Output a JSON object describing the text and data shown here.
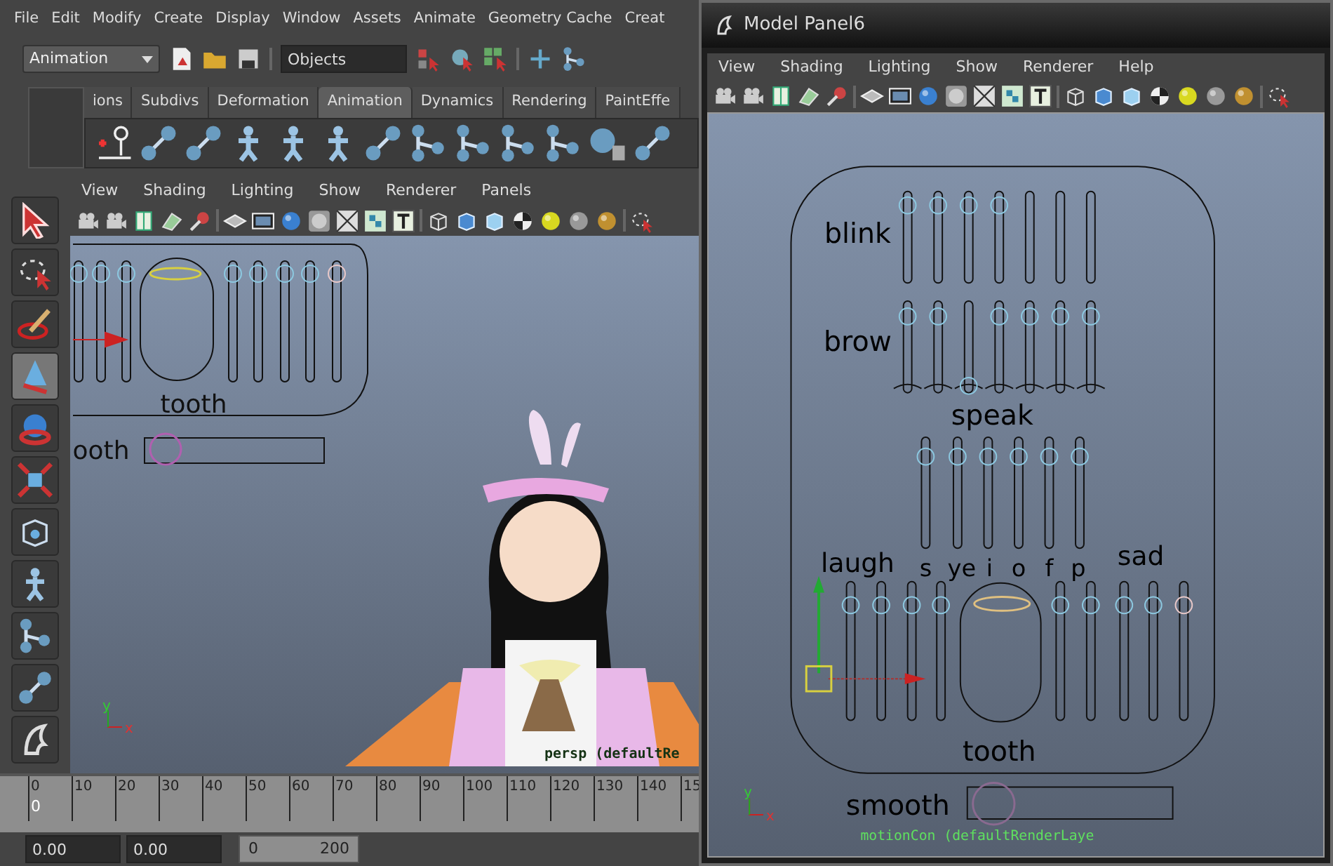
{
  "main_window": {
    "menu": [
      "File",
      "Edit",
      "Modify",
      "Create",
      "Display",
      "Window",
      "Assets",
      "Animate",
      "Geometry Cache",
      "Creat"
    ],
    "mode_menu": "Animation",
    "selection_mask": "Objects",
    "shelf_tabs": [
      {
        "label": "ions",
        "selected": false
      },
      {
        "label": "Subdivs",
        "selected": false
      },
      {
        "label": "Deformation",
        "selected": false
      },
      {
        "label": "Animation",
        "selected": true
      },
      {
        "label": "Dynamics",
        "selected": false
      },
      {
        "label": "Rendering",
        "selected": false
      },
      {
        "label": "PaintEffe",
        "selected": false
      }
    ],
    "viewport": {
      "menu": [
        "View",
        "Shading",
        "Lighting",
        "Show",
        "Renderer",
        "Panels"
      ],
      "rig_labels": [
        "tooth",
        "ooth"
      ],
      "camera_label": "persp (defaultRe",
      "axis_labels": [
        "y",
        "x"
      ]
    },
    "timeline": {
      "ticks": [
        "0",
        "10",
        "20",
        "30",
        "40",
        "50",
        "60",
        "70",
        "80",
        "90",
        "100",
        "110",
        "120",
        "130",
        "140",
        "15"
      ],
      "current_frame": "0"
    },
    "time_fields": [
      "0.00",
      "0.00"
    ],
    "range": {
      "start": "0",
      "end": "200"
    }
  },
  "model_panel": {
    "title": "Model Panel6",
    "menu": [
      "View",
      "Shading",
      "Lighting",
      "Show",
      "Renderer",
      "Help"
    ],
    "rig_labels": [
      "blink",
      "brow",
      "speak",
      "laugh",
      "s",
      "ye",
      "i",
      "o",
      "f",
      "p",
      "sad",
      "tooth",
      "smooth"
    ],
    "camera_label": "motionCon (defaultRenderLaye",
    "axis_labels": [
      "y",
      "x"
    ]
  }
}
